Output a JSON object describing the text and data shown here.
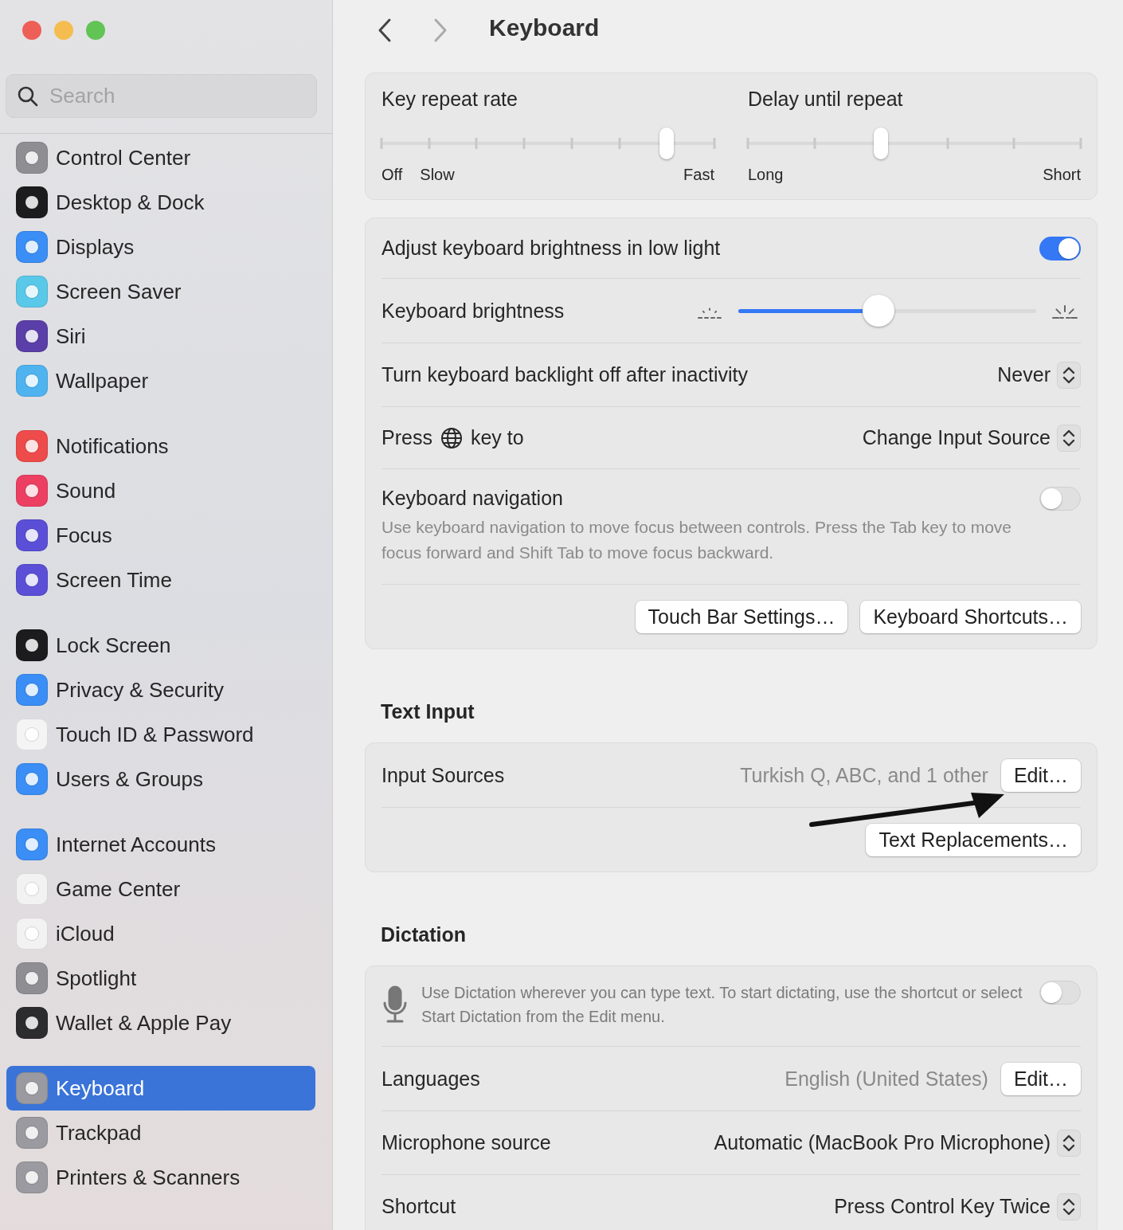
{
  "sidebar": {
    "search": {
      "placeholder": "Search"
    },
    "groups": [
      {
        "items": [
          {
            "label": "Control Center",
            "color": "#8e8e93",
            "selected": false
          },
          {
            "label": "Desktop & Dock",
            "color": "#1c1c1e",
            "selected": false
          },
          {
            "label": "Displays",
            "color": "#3a8ef6",
            "selected": false
          },
          {
            "label": "Screen Saver",
            "color": "#5ac8e8",
            "selected": false
          },
          {
            "label": "Siri",
            "color": "#5b3fa8",
            "selected": false
          },
          {
            "label": "Wallpaper",
            "color": "#4fb3f0",
            "selected": false
          }
        ]
      },
      {
        "items": [
          {
            "label": "Notifications",
            "color": "#ee4b4b",
            "selected": false
          },
          {
            "label": "Sound",
            "color": "#ec3f62",
            "selected": false
          },
          {
            "label": "Focus",
            "color": "#5a4fd6",
            "selected": false
          },
          {
            "label": "Screen Time",
            "color": "#5a4fd6",
            "selected": false
          }
        ]
      },
      {
        "items": [
          {
            "label": "Lock Screen",
            "color": "#1c1c1e",
            "selected": false
          },
          {
            "label": "Privacy & Security",
            "color": "#3a8ef6",
            "selected": false
          },
          {
            "label": "Touch ID & Password",
            "color": "#f4f4f4",
            "selected": false
          },
          {
            "label": "Users & Groups",
            "color": "#3a8ef6",
            "selected": false
          }
        ]
      },
      {
        "items": [
          {
            "label": "Internet Accounts",
            "color": "#3a8ef6",
            "selected": false
          },
          {
            "label": "Game Center",
            "color": "#f2f2f2",
            "selected": false
          },
          {
            "label": "iCloud",
            "color": "#f2f2f2",
            "selected": false
          },
          {
            "label": "Spotlight",
            "color": "#8e8e93",
            "selected": false
          },
          {
            "label": "Wallet & Apple Pay",
            "color": "#2c2c2e",
            "selected": false
          }
        ]
      },
      {
        "items": [
          {
            "label": "Keyboard",
            "color": "#9a9aa0",
            "selected": true
          },
          {
            "label": "Trackpad",
            "color": "#9a9aa0",
            "selected": false
          },
          {
            "label": "Printers & Scanners",
            "color": "#9a9aa0",
            "selected": false
          }
        ]
      }
    ]
  },
  "toolbar": {
    "title": "Keyboard"
  },
  "content": [
    {
      "kind": "sliders",
      "sliders": [
        {
          "kind": "rate",
          "label": "Key repeat rate",
          "level": 0.857,
          "tick_labels": [
            "Off",
            "Slow",
            "Fast"
          ]
        },
        {
          "kind": "delay",
          "label": "Delay until repeat",
          "level": 0.4,
          "tick_labels": [
            "Long",
            "Short"
          ]
        }
      ]
    },
    {
      "kind": "panel",
      "rows": [
        {
          "kind": "toggle",
          "label": "Adjust keyboard brightness in low light",
          "on": true
        },
        {
          "kind": "brightness",
          "label": "Keyboard brightness",
          "level": 0.47
        },
        {
          "kind": "popup",
          "label": "Turn keyboard backlight off after inactivity",
          "value": "Never"
        },
        {
          "kind": "globe_popup",
          "label_before": "Press",
          "label_after": "key to",
          "value": "Change Input Source"
        },
        {
          "kind": "toggle_note",
          "label": "Keyboard navigation",
          "on": false,
          "description": "Use keyboard navigation to move focus between controls. Press the Tab key to move focus forward and Shift Tab to move focus backward."
        },
        {
          "kind": "buttons",
          "buttons": [
            "Touch Bar Settings…",
            "Keyboard Shortcuts…"
          ]
        }
      ]
    },
    {
      "kind": "heading",
      "text": "Text Input"
    },
    {
      "kind": "panel",
      "arrow": true,
      "rows": [
        {
          "kind": "info_button",
          "label": "Input Sources",
          "value": "Turkish Q, ABC, and 1 other",
          "button": "Edit…"
        },
        {
          "kind": "buttons",
          "buttons": [
            "Text Replacements…"
          ]
        }
      ]
    },
    {
      "kind": "heading",
      "text": "Dictation"
    },
    {
      "kind": "panel",
      "rows": [
        {
          "kind": "mic_toggle",
          "description": "Use Dictation wherever you can type text. To start dictating, use the shortcut or select Start Dictation from the Edit menu.",
          "on": false
        },
        {
          "kind": "info_button",
          "label": "Languages",
          "value": "English (United States)",
          "button": "Edit…"
        },
        {
          "kind": "popup",
          "label": "Microphone source",
          "value": "Automatic (MacBook Pro Microphone)"
        },
        {
          "kind": "popup",
          "label": "Shortcut",
          "value": "Press Control Key Twice"
        }
      ]
    }
  ]
}
